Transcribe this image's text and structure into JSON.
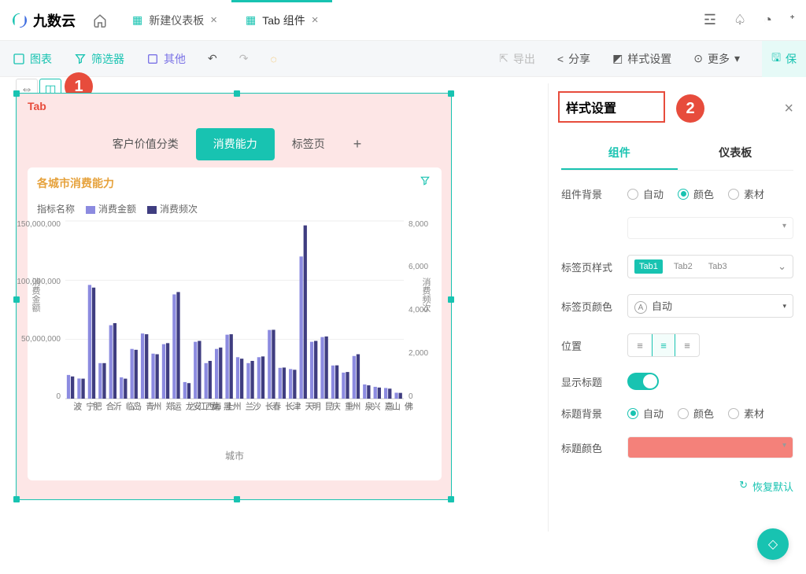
{
  "brand": "九数云",
  "top_tabs": [
    {
      "label": "新建仪表板",
      "active": false
    },
    {
      "label": "Tab 组件",
      "active": true
    }
  ],
  "toolbar": {
    "chart": "图表",
    "filter": "筛选器",
    "other": "其他",
    "export": "导出",
    "share": "分享",
    "style": "样式设置",
    "more": "更多",
    "save": "保"
  },
  "annotations": {
    "one": "1",
    "two": "2"
  },
  "tab_widget": {
    "title": "Tab",
    "nav": [
      "客户价值分类",
      "消费能力",
      "标签页"
    ],
    "active_index": 1
  },
  "chart": {
    "title": "各城市消费能力",
    "legend_label": "指标名称",
    "series_names": [
      "消费金额",
      "消费频次"
    ],
    "xlabel": "城市",
    "y1_label": "消费金额",
    "y2_label": "消费频次",
    "y1_ticks": [
      "0",
      "50,000,000",
      "100,000,000",
      "150,000,000"
    ],
    "y2_ticks": [
      "0",
      "2,000",
      "4,000",
      "6,000",
      "8,000"
    ]
  },
  "chart_data": {
    "type": "bar",
    "title": "各城市消费能力",
    "xlabel": "城市",
    "x_tick_labels_shown": [
      "宁波",
      "合肥",
      "临沂",
      "青岛",
      "郑州",
      "黑龙江龙运",
      "西安",
      "上海",
      "兰州",
      "长沙",
      "长春",
      "天津",
      "昆明",
      "重庆",
      "泉州",
      "嘉兴",
      "佛山"
    ],
    "y_left": {
      "label": "消费金额",
      "lim": [
        0,
        150000000
      ],
      "ticks": [
        0,
        50000000,
        100000000,
        150000000
      ]
    },
    "y_right": {
      "label": "消费频次",
      "lim": [
        0,
        8000
      ],
      "ticks": [
        0,
        2000,
        4000,
        6000,
        8000
      ]
    },
    "series": [
      {
        "name": "消费金额",
        "axis": "left",
        "color": "#8c8be0",
        "values": [
          20000000,
          17000000,
          96000000,
          30000000,
          62000000,
          18000000,
          42000000,
          55000000,
          38000000,
          46000000,
          88000000,
          14000000,
          48000000,
          30000000,
          42000000,
          54000000,
          35000000,
          30000000,
          35000000,
          58000000,
          26000000,
          25000000,
          120000000,
          48000000,
          52000000,
          28000000,
          22000000,
          36000000,
          12000000,
          10000000,
          9000000,
          5000000
        ]
      },
      {
        "name": "消费频次",
        "axis": "right",
        "color": "#3f3d80",
        "values": [
          1000,
          900,
          5000,
          1600,
          3400,
          900,
          2200,
          2900,
          2000,
          2500,
          4800,
          700,
          2600,
          1700,
          2300,
          2900,
          1800,
          1700,
          1900,
          3100,
          1400,
          1300,
          7800,
          2600,
          2800,
          1500,
          1200,
          2000,
          600,
          500,
          450,
          260
        ]
      }
    ],
    "note": "Category axis has ~32 bars; only 17 city tick labels are printed (sparse labeling). Values estimated from plot."
  },
  "panel": {
    "title": "样式设置",
    "tabs": [
      "组件",
      "仪表板"
    ],
    "active_tab": 0,
    "rows": {
      "component_bg": {
        "label": "组件背景",
        "options": [
          "自动",
          "颜色",
          "素材"
        ],
        "selected": "颜色",
        "swatch": "#fde6e6"
      },
      "tab_style": {
        "label": "标签页样式",
        "chips": [
          "Tab1",
          "Tab2",
          "Tab3"
        ]
      },
      "tab_color": {
        "label": "标签页颜色",
        "value": "自动"
      },
      "position": {
        "label": "位置",
        "selected": 1
      },
      "show_title": {
        "label": "显示标题",
        "on": true
      },
      "title_bg": {
        "label": "标题背景",
        "options": [
          "自动",
          "颜色",
          "素材"
        ],
        "selected": "自动"
      },
      "title_color": {
        "label": "标题颜色",
        "swatch": "#f4817a"
      }
    },
    "reset": "恢复默认"
  }
}
